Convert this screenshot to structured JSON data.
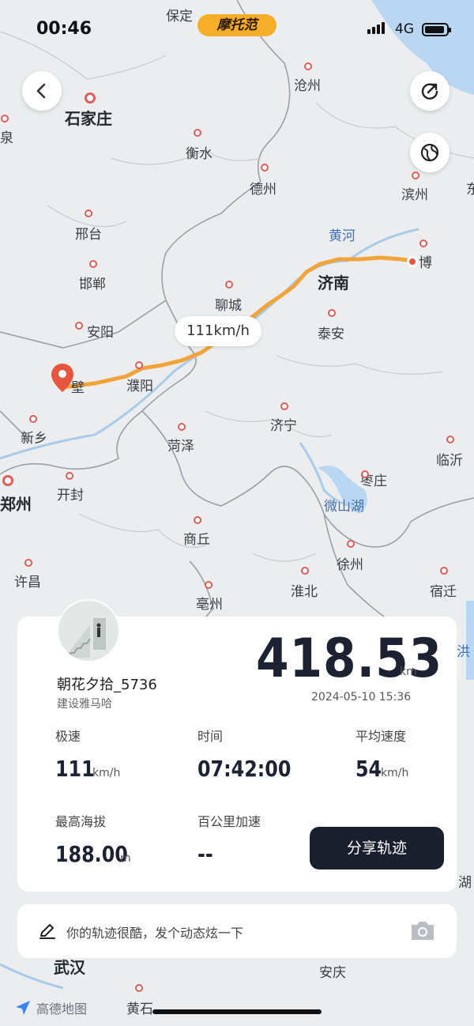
{
  "status_bar": {
    "time": "00:46",
    "network": "4G"
  },
  "brand_label": "摩托范",
  "map": {
    "cities": [
      {
        "name": "保定",
        "cls": ""
      },
      {
        "name": "沧州",
        "cls": ""
      },
      {
        "name": "石家庄",
        "cls": "big"
      },
      {
        "name": "泉",
        "cls": ""
      },
      {
        "name": "衡水",
        "cls": ""
      },
      {
        "name": "德州",
        "cls": ""
      },
      {
        "name": "滨州",
        "cls": ""
      },
      {
        "name": "东",
        "cls": ""
      },
      {
        "name": "邢台",
        "cls": ""
      },
      {
        "name": "黄河",
        "cls": "water"
      },
      {
        "name": "博",
        "cls": ""
      },
      {
        "name": "邯郸",
        "cls": ""
      },
      {
        "name": "济南",
        "cls": "big"
      },
      {
        "name": "聊城",
        "cls": ""
      },
      {
        "name": "安阳",
        "cls": ""
      },
      {
        "name": "泰安",
        "cls": ""
      },
      {
        "name": "壁",
        "cls": ""
      },
      {
        "name": "濮阳",
        "cls": ""
      },
      {
        "name": "新乡",
        "cls": ""
      },
      {
        "name": "菏泽",
        "cls": ""
      },
      {
        "name": "济宁",
        "cls": ""
      },
      {
        "name": "临沂",
        "cls": ""
      },
      {
        "name": "枣庄",
        "cls": ""
      },
      {
        "name": "郑州",
        "cls": "big"
      },
      {
        "name": "开封",
        "cls": ""
      },
      {
        "name": "微山湖",
        "cls": "water"
      },
      {
        "name": "商丘",
        "cls": ""
      },
      {
        "name": "徐州",
        "cls": ""
      },
      {
        "name": "许昌",
        "cls": ""
      },
      {
        "name": "淮北",
        "cls": ""
      },
      {
        "name": "宿迁",
        "cls": ""
      },
      {
        "name": "亳州",
        "cls": ""
      },
      {
        "name": "洪",
        "cls": "water"
      },
      {
        "name": "湖",
        "cls": ""
      },
      {
        "name": "武汉",
        "cls": "big"
      },
      {
        "name": "安庆",
        "cls": ""
      },
      {
        "name": "黄石",
        "cls": ""
      }
    ],
    "speed_label": "111km/h",
    "watermark": "高德地图"
  },
  "summary": {
    "username": "朝花夕拾_5736",
    "subname": "建设雅马哈",
    "distance": "418.53",
    "distance_unit": "km",
    "datetime": "2024-05-10 15:36"
  },
  "stats": {
    "top_speed": {
      "label": "极速",
      "value": "111",
      "unit": "km/h"
    },
    "duration": {
      "label": "时间",
      "value": "07:42:00"
    },
    "avg_speed": {
      "label": "平均速度",
      "value": "54",
      "unit": "km/h"
    },
    "max_altitude": {
      "label": "最高海拔",
      "value": "188.00",
      "unit": "m"
    },
    "accel_100": {
      "label": "百公里加速",
      "value": "--"
    }
  },
  "share_button": "分享轨迹",
  "post_prompt": "你的轨迹很酷，发个动态炫一下",
  "colors": {
    "track": "#f2a33a",
    "button": "#1a1f2e",
    "brand": "#f6ad2a",
    "pin": "#e8553f"
  }
}
